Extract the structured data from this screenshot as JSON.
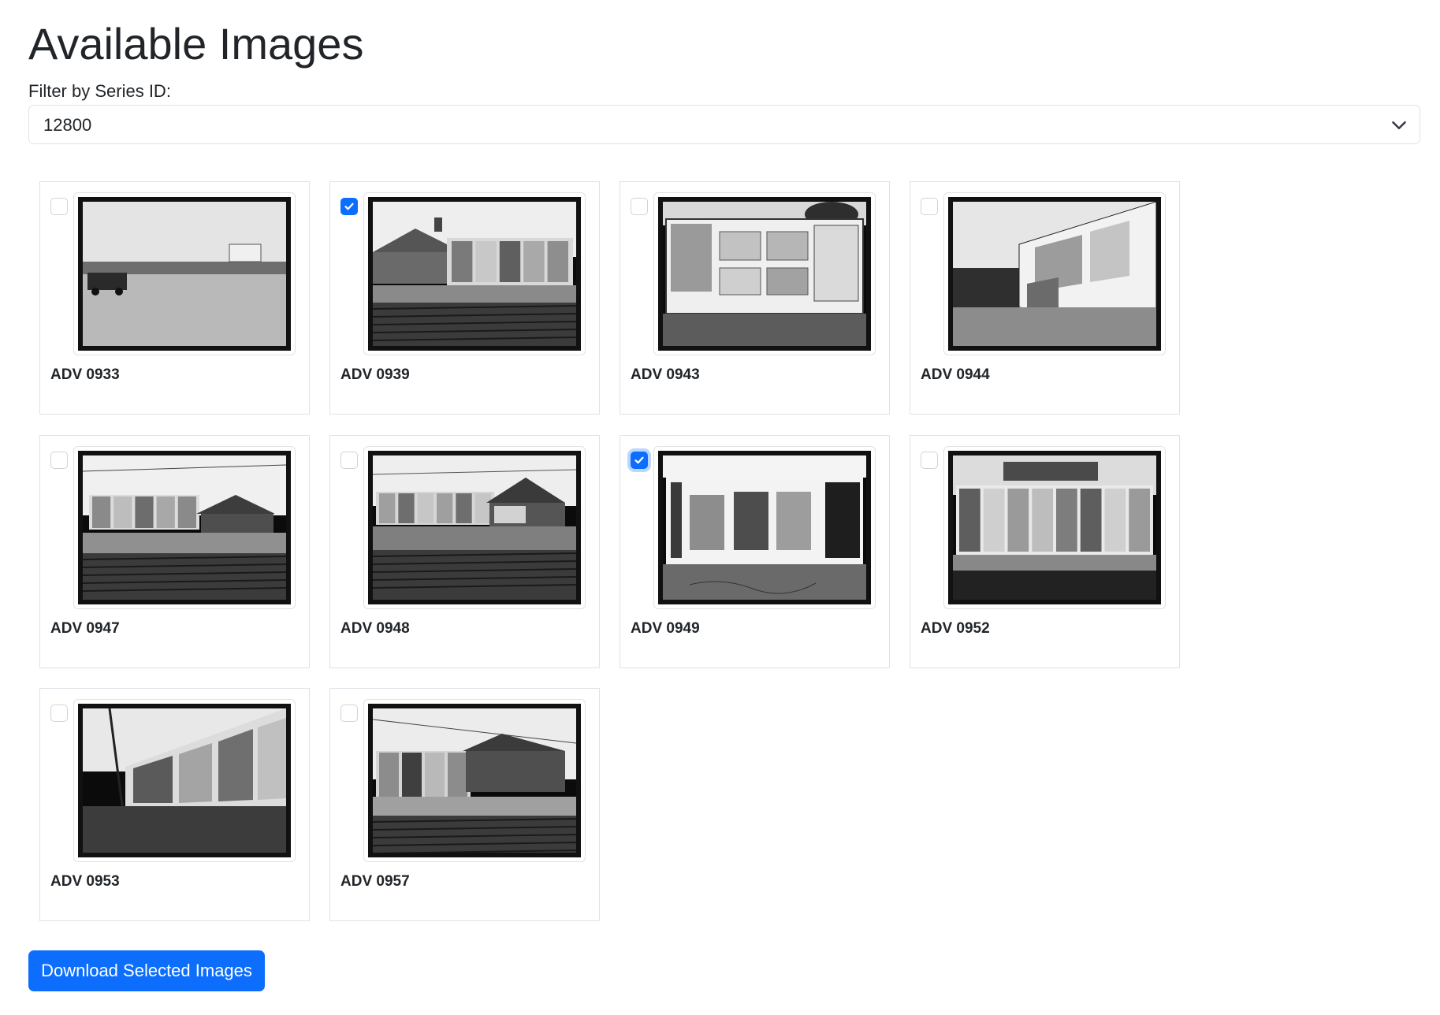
{
  "page": {
    "title": "Available Images",
    "filter_label": "Filter by Series ID:",
    "filter_value": "12800"
  },
  "images": [
    {
      "id": "ADV 0933",
      "checked": false,
      "alt": "ADV 0933"
    },
    {
      "id": "ADV 0939",
      "checked": true,
      "alt": "ADV 0939"
    },
    {
      "id": "ADV 0943",
      "checked": false,
      "alt": "ADV 0943"
    },
    {
      "id": "ADV 0944",
      "checked": false,
      "alt": "ADV 0944"
    },
    {
      "id": "ADV 0947",
      "checked": false,
      "alt": "ADV 0947"
    },
    {
      "id": "ADV 0948",
      "checked": false,
      "alt": "ADV 0948"
    },
    {
      "id": "ADV 0949",
      "checked": true,
      "focused": true,
      "alt": "ADV 0949"
    },
    {
      "id": "ADV 0952",
      "checked": false,
      "alt": "ADV 0952"
    },
    {
      "id": "ADV 0953",
      "checked": false,
      "alt": "ADV 0953"
    },
    {
      "id": "ADV 0957",
      "checked": false,
      "alt": "ADV 0957"
    }
  ],
  "download_button": "Download Selected Images",
  "colors": {
    "accent": "#0d6efd",
    "text": "#212529",
    "border": "#dee2e6"
  }
}
